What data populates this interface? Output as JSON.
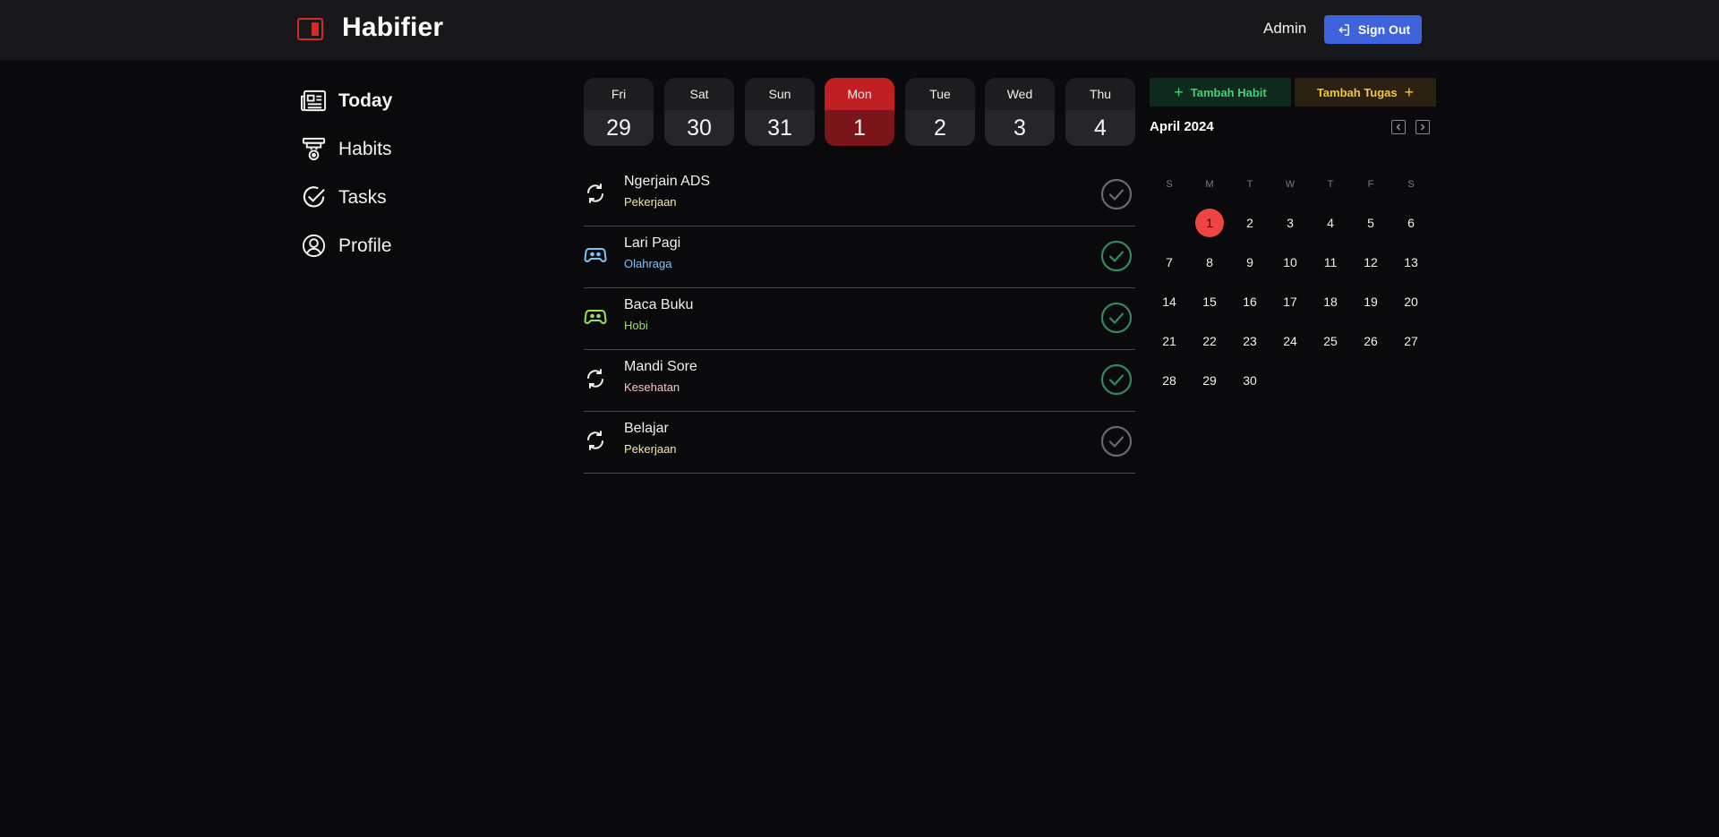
{
  "app": {
    "title": "Habifier"
  },
  "header": {
    "user": "Admin",
    "signout_label": "Sign Out"
  },
  "nav": [
    {
      "label": "Today",
      "icon": "newspaper-icon",
      "active": true
    },
    {
      "label": "Habits",
      "icon": "habit-icon",
      "active": false
    },
    {
      "label": "Tasks",
      "icon": "check-circle-icon",
      "active": false
    },
    {
      "label": "Profile",
      "icon": "user-circle-icon",
      "active": false
    }
  ],
  "days": [
    {
      "name": "Fri",
      "num": "29",
      "active": false
    },
    {
      "name": "Sat",
      "num": "30",
      "active": false
    },
    {
      "name": "Sun",
      "num": "31",
      "active": false
    },
    {
      "name": "Mon",
      "num": "1",
      "active": true
    },
    {
      "name": "Tue",
      "num": "2",
      "active": false
    },
    {
      "name": "Wed",
      "num": "3",
      "active": false
    },
    {
      "name": "Thu",
      "num": "4",
      "active": false
    }
  ],
  "tasks": [
    {
      "name": "Ngerjain ADS",
      "category": "Pekerjaan",
      "category_color": "#f5e6a8",
      "icon": "repeat-icon",
      "icon_color": "#f0f0f0",
      "done": false
    },
    {
      "name": "Lari Pagi",
      "category": "Olahraga",
      "category_color": "#7fc4f0",
      "icon": "gamepad-icon",
      "icon_color": "#7fc4f0",
      "done": true
    },
    {
      "name": "Baca Buku",
      "category": "Hobi",
      "category_color": "#9ae05a",
      "icon": "gamepad-icon",
      "icon_color": "#9ae05a",
      "done": true
    },
    {
      "name": "Mandi Sore",
      "category": "Kesehatan",
      "category_color": "#f4c8c8",
      "icon": "repeat-icon",
      "icon_color": "#f0f0f0",
      "done": true
    },
    {
      "name": "Belajar",
      "category": "Pekerjaan",
      "category_color": "#f5e6a8",
      "icon": "repeat-icon",
      "icon_color": "#f0f0f0",
      "done": false
    }
  ],
  "actions": {
    "add_habit": "Tambah Habit",
    "add_task": "Tambah Tugas"
  },
  "calendar": {
    "month_label": "April 2024",
    "weekdays": [
      "S",
      "M",
      "T",
      "W",
      "T",
      "F",
      "S"
    ],
    "first_weekday": 1,
    "days_in_month": 30,
    "today": 1
  },
  "colors": {
    "accent_red": "#c01f24",
    "brand_blue": "#3e63dd",
    "check_done": "#2f8a5c",
    "check_pending": "#6a6a6e"
  }
}
